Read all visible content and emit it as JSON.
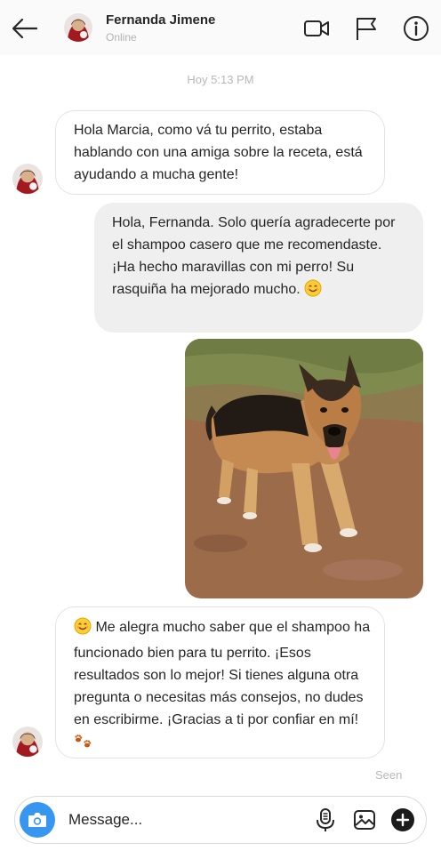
{
  "header": {
    "name": "Fernanda Jimene",
    "status": "Online",
    "icons": [
      "back-arrow-icon",
      "video-call-icon",
      "flag-icon",
      "info-icon"
    ]
  },
  "conversation": {
    "timestamp": "Hoy 5:13 PM",
    "messages": [
      {
        "sender": "Fernanda Jimene",
        "text": "Hola Marcia, como vá tu perrito, estaba hablando con una amiga sobre la receta, está ayudando a mucha gente!"
      },
      {
        "sender": "me",
        "text": "Hola, Fernanda. Solo quería agradecerte por el shampoo casero que me recomendaste. ¡Ha hecho maravillas con mi perro! Su rasquiña ha mejorado mucho.",
        "trailing_emoji": "smiling-face"
      },
      {
        "sender": "me",
        "attachment": "dog-photo"
      },
      {
        "sender": "Fernanda Jimene",
        "leading_emoji": "smiling-face",
        "text": "Me alegra mucho saber que el shampoo ha funcionado bien para tu perrito. ¡Esos resultados son lo mejor! Si tienes alguna otra pregunta o necesitas más consejos, no dudes en escribirme. ¡Gracias a ti por confiar en mí!",
        "trailing_emoji": "paw-prints"
      }
    ],
    "seen_label": "Seen"
  },
  "composer": {
    "placeholder": "Message...",
    "icons": [
      "camera-icon",
      "microphone-icon",
      "image-icon",
      "plus-icon"
    ]
  },
  "colors": {
    "accent": "#3797f0",
    "outgoing_bubble": "#efefef",
    "incoming_border": "#e3e3e3",
    "muted_text": "#b8b8b8",
    "header_bg": "#fafafa"
  }
}
